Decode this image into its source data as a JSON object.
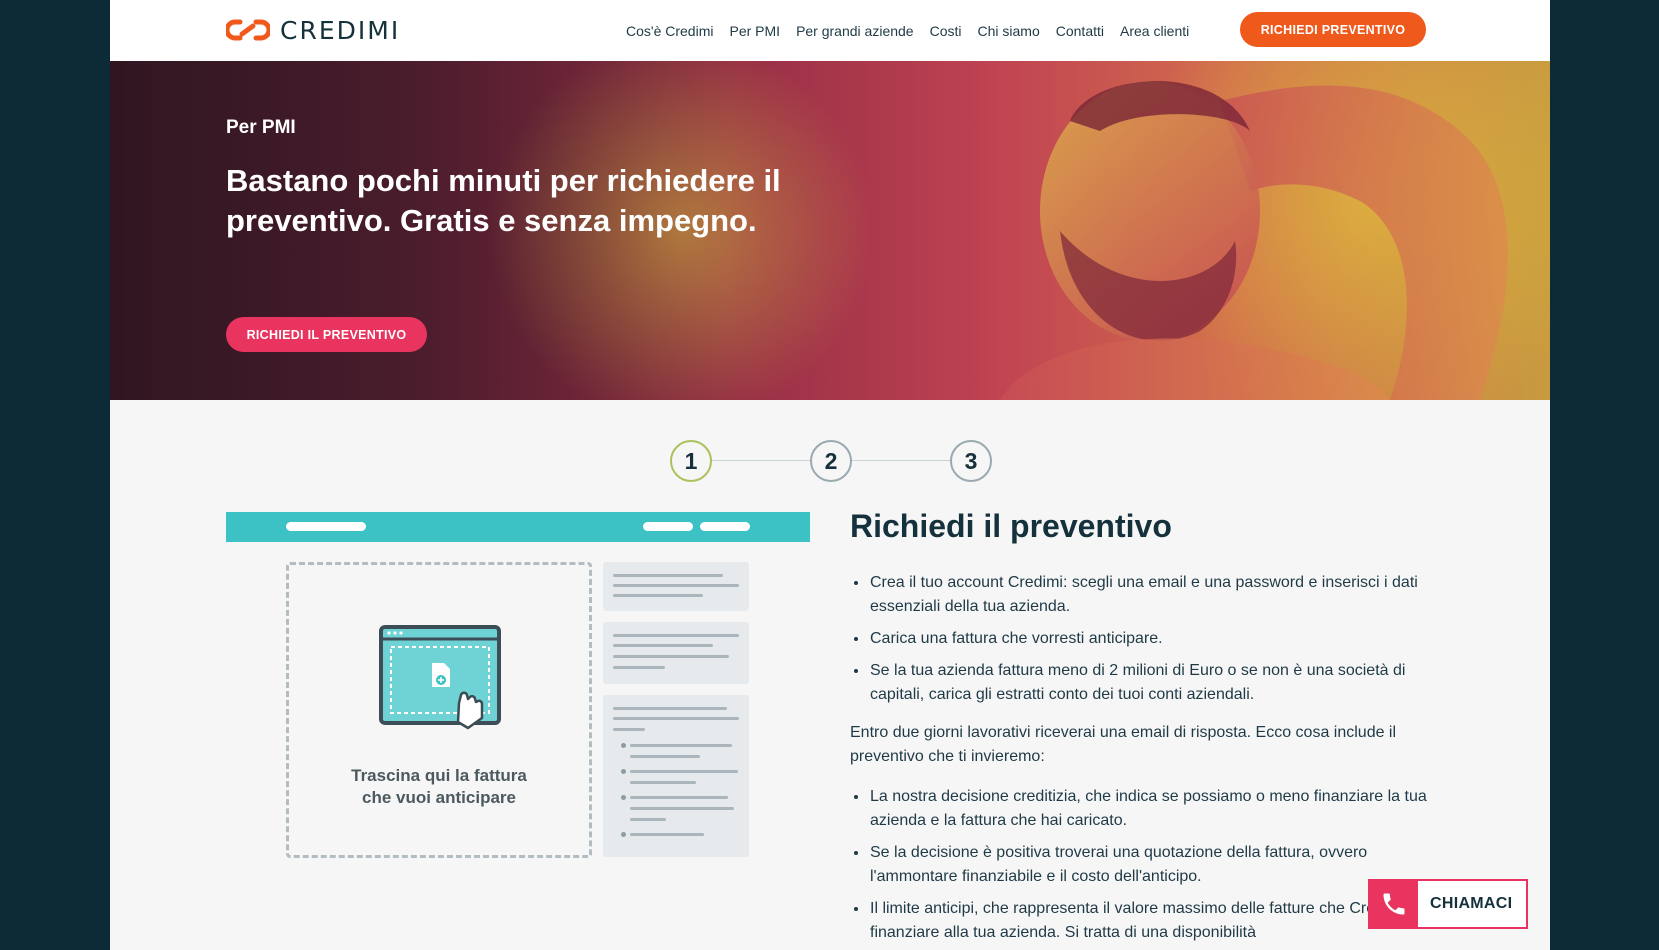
{
  "brand": {
    "name": "CREDIMI"
  },
  "nav": {
    "items": [
      {
        "label": "Cos'è Credimi"
      },
      {
        "label": "Per PMI"
      },
      {
        "label": "Per grandi aziende"
      },
      {
        "label": "Costi"
      },
      {
        "label": "Chi siamo"
      },
      {
        "label": "Contatti"
      },
      {
        "label": "Area clienti"
      }
    ],
    "cta_label": "RICHIEDI PREVENTIVO"
  },
  "hero": {
    "subtitle": "Per PMI",
    "title": "Bastano pochi minuti per richiedere il preventivo. Gratis e senza impegno.",
    "cta_label": "RICHIEDI IL PREVENTIVO"
  },
  "steps": {
    "items": [
      "1",
      "2",
      "3"
    ],
    "active": 1
  },
  "illustration": {
    "drop_text_line1": "Trascina qui la fattura",
    "drop_text_line2": "che vuoi anticipare"
  },
  "content": {
    "title": "Richiedi il preventivo",
    "list1": [
      "Crea il tuo account Credimi: scegli una email e una password e inserisci i dati essenziali della tua azienda.",
      "Carica una fattura che vorresti anticipare.",
      "Se la tua azienda fattura meno di 2 milioni di Euro o se non è una società di capitali, carica gli estratti conto dei tuoi conti aziendali."
    ],
    "paragraph": "Entro due giorni lavorativi riceverai una email di risposta. Ecco cosa include il preventivo che ti invieremo:",
    "list2": [
      "La nostra decisione creditizia, che indica se possiamo o meno finanziare la tua azienda e la fattura che hai caricato.",
      "Se la decisione è positiva troverai una quotazione della fattura, ovvero l'ammontare finanziabile e il costo dell'anticipo.",
      "Il limite anticipi, che rappresenta il valore massimo delle fatture che Credimi può finanziare alla tua azienda. Si tratta di una disponibilità"
    ]
  },
  "call": {
    "label": "CHIAMACI"
  },
  "colors": {
    "orange": "#ef5a1c",
    "pink": "#e8345f",
    "teal": "#3cc1c4",
    "navy": "#14313c",
    "step_active": "#a9c25b"
  }
}
